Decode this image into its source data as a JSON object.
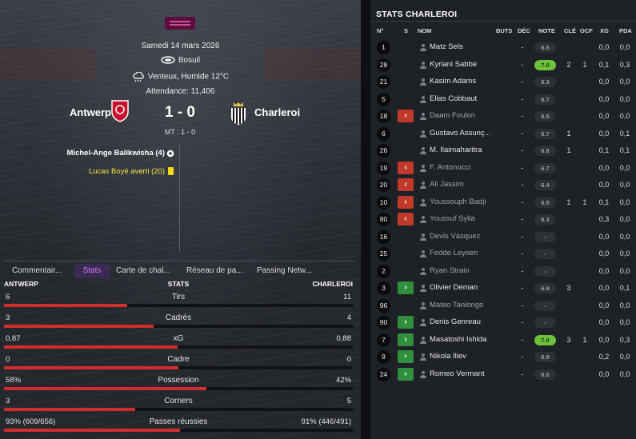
{
  "match": {
    "date": "Samedi 14 mars 2026",
    "stadium": "Bosuil",
    "weather": "Venteux, Humide 12°C",
    "attendance": "Attendance: 11,406",
    "home": "Antwerp",
    "away": "Charleroi",
    "score": "1 - 0",
    "halftime": "MT : 1 - 0",
    "events": [
      {
        "text": "Michel-Ange Balikwisha (4)",
        "icon": "football-icon"
      },
      {
        "text": "Lucas Boyé averti (20)",
        "icon": "yellow-card-icon"
      }
    ]
  },
  "tabs": [
    "Commentair...",
    "Stats",
    "Carte de chal...",
    "Réseau de pa...",
    "Passing Netw..."
  ],
  "active_tab": "Stats",
  "stats_header": {
    "home": "ANTWERP",
    "label": "STATS",
    "away": "CHARLEROI"
  },
  "stats": [
    {
      "label": "Tirs",
      "home": "6",
      "away": "11",
      "home_share": 0.353
    },
    {
      "label": "Cadrés",
      "home": "3",
      "away": "4",
      "home_share": 0.429
    },
    {
      "label": "xG",
      "home": "0,87",
      "away": "0,88",
      "home_share": 0.497
    },
    {
      "label": "Cadre",
      "home": "0",
      "away": "0",
      "home_share": 0.5
    },
    {
      "label": "Possession",
      "home": "58%",
      "away": "42%",
      "home_share": 0.58
    },
    {
      "label": "Corners",
      "home": "3",
      "away": "5",
      "home_share": 0.375
    },
    {
      "label": "Passes réussies",
      "home": "93% (609/656)",
      "away": "91% (446/491)",
      "home_share": 0.505
    }
  ],
  "panel_title": "STATS CHARLEROI",
  "columns": [
    "N°",
    "S",
    "NOM",
    "BUTS",
    "DÉC",
    "NOTE",
    "CLÉ",
    "OCF",
    "XG",
    "PDA"
  ],
  "players": [
    {
      "num": "1",
      "sub": "",
      "name": "Matz Sels",
      "buts": "",
      "dec": "-",
      "note": "6.5",
      "cle": "",
      "ocf": "",
      "xg": "0,0",
      "pda": "0,0",
      "dim": false,
      "hi": false
    },
    {
      "num": "28",
      "sub": "",
      "name": "Kyriani Sabbe",
      "buts": "",
      "dec": "-",
      "note": "7.0",
      "cle": "2",
      "ocf": "1",
      "xg": "0,1",
      "pda": "0,3",
      "dim": false,
      "hi": true
    },
    {
      "num": "21",
      "sub": "",
      "name": "Kasim Adams",
      "buts": "",
      "dec": "-",
      "note": "6.3",
      "cle": "",
      "ocf": "",
      "xg": "0,0",
      "pda": "0,0",
      "dim": false,
      "hi": false
    },
    {
      "num": "5",
      "sub": "",
      "name": "Elias Cobbaut",
      "buts": "",
      "dec": "-",
      "note": "6.7",
      "cle": "",
      "ocf": "",
      "xg": "0,0",
      "pda": "0,0",
      "dim": false,
      "hi": false
    },
    {
      "num": "18",
      "sub": "out",
      "name": "Daam Foulon",
      "buts": "",
      "dec": "-",
      "note": "6.5",
      "cle": "",
      "ocf": "",
      "xg": "0,0",
      "pda": "0,0",
      "dim": true,
      "hi": false
    },
    {
      "num": "6",
      "sub": "",
      "name": "Gustavo Assunç...",
      "buts": "",
      "dec": "-",
      "note": "6.7",
      "cle": "1",
      "ocf": "",
      "xg": "0,0",
      "pda": "0,1",
      "dim": false,
      "hi": false
    },
    {
      "num": "26",
      "sub": "",
      "name": "M. Ilaimaharitra",
      "buts": "",
      "dec": "-",
      "note": "6.8",
      "cle": "1",
      "ocf": "",
      "xg": "0,1",
      "pda": "0,1",
      "dim": false,
      "hi": false
    },
    {
      "num": "19",
      "sub": "out",
      "name": "F. Antonucci",
      "buts": "",
      "dec": "-",
      "note": "6.7",
      "cle": "",
      "ocf": "",
      "xg": "0,0",
      "pda": "0,0",
      "dim": true,
      "hi": false
    },
    {
      "num": "20",
      "sub": "out",
      "name": "Ali Jassim",
      "buts": "",
      "dec": "-",
      "note": "6.4",
      "cle": "",
      "ocf": "",
      "xg": "0,0",
      "pda": "0,0",
      "dim": true,
      "hi": false
    },
    {
      "num": "10",
      "sub": "out",
      "name": "Youssouph Badji",
      "buts": "",
      "dec": "-",
      "note": "6.5",
      "cle": "1",
      "ocf": "1",
      "xg": "0,1",
      "pda": "0,0",
      "dim": true,
      "hi": false
    },
    {
      "num": "80",
      "sub": "out",
      "name": "Youssuf Sylla",
      "buts": "",
      "dec": "-",
      "note": "6.3",
      "cle": "",
      "ocf": "",
      "xg": "0,3",
      "pda": "0,0",
      "dim": true,
      "hi": false
    },
    {
      "num": "16",
      "sub": "",
      "name": "Devis Vásquez",
      "buts": "",
      "dec": "-",
      "note": "-",
      "cle": "",
      "ocf": "",
      "xg": "0,0",
      "pda": "0,0",
      "dim": true,
      "hi": false
    },
    {
      "num": "25",
      "sub": "",
      "name": "Fedde Leysen",
      "buts": "",
      "dec": "-",
      "note": "-",
      "cle": "",
      "ocf": "",
      "xg": "0,0",
      "pda": "0,0",
      "dim": true,
      "hi": false
    },
    {
      "num": "2",
      "sub": "",
      "name": "Ryan Strain",
      "buts": "",
      "dec": "-",
      "note": "-",
      "cle": "",
      "ocf": "",
      "xg": "0,0",
      "pda": "0,0",
      "dim": true,
      "hi": false
    },
    {
      "num": "3",
      "sub": "in",
      "name": "Olivier Deman",
      "buts": "",
      "dec": "-",
      "note": "6.9",
      "cle": "3",
      "ocf": "",
      "xg": "0,0",
      "pda": "0,1",
      "dim": false,
      "hi": false
    },
    {
      "num": "96",
      "sub": "",
      "name": "Mateo Tanlongo",
      "buts": "",
      "dec": "-",
      "note": "-",
      "cle": "",
      "ocf": "",
      "xg": "0,0",
      "pda": "0,0",
      "dim": true,
      "hi": false
    },
    {
      "num": "90",
      "sub": "in",
      "name": "Denis Genreau",
      "buts": "",
      "dec": "-",
      "note": "-",
      "cle": "",
      "ocf": "",
      "xg": "0,0",
      "pda": "0,0",
      "dim": false,
      "hi": false
    },
    {
      "num": "7",
      "sub": "in",
      "name": "Masatoshi Ishida",
      "buts": "",
      "dec": "-",
      "note": "7.0",
      "cle": "3",
      "ocf": "1",
      "xg": "0,0",
      "pda": "0,3",
      "dim": false,
      "hi": true
    },
    {
      "num": "9",
      "sub": "in",
      "name": "Nikola Iliev",
      "buts": "",
      "dec": "-",
      "note": "6.9",
      "cle": "",
      "ocf": "",
      "xg": "0,2",
      "pda": "0,0",
      "dim": false,
      "hi": false
    },
    {
      "num": "24",
      "sub": "in",
      "name": "Romeo Vermant",
      "buts": "",
      "dec": "-",
      "note": "6.6",
      "cle": "",
      "ocf": "",
      "xg": "0,0",
      "pda": "0,0",
      "dim": false,
      "hi": false
    }
  ],
  "colors": {
    "accent": "#d07de5",
    "bar": "#d12d2d",
    "sub_out": "#c0392b",
    "sub_in": "#2f8f3e",
    "note_high": "#6cc23a"
  }
}
